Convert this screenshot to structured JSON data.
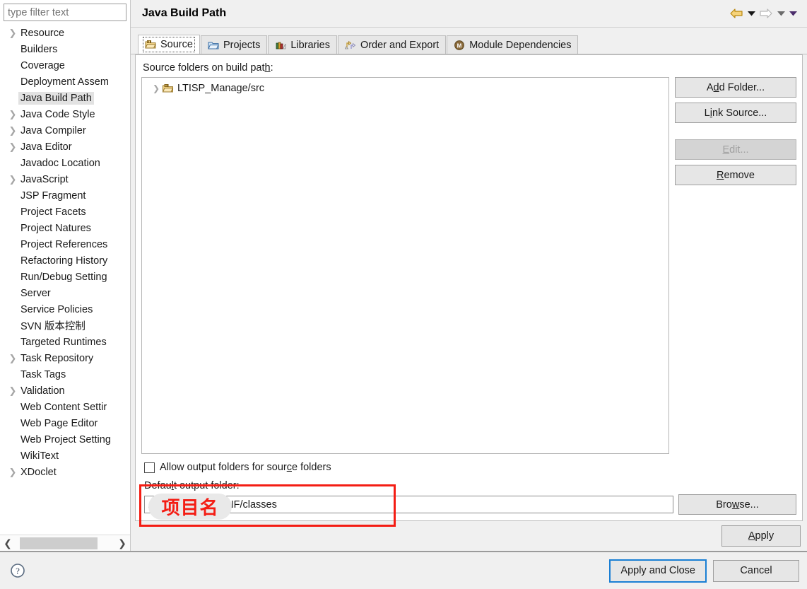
{
  "sidebar": {
    "filter": {
      "placeholder": "type filter text",
      "value": ""
    },
    "items": [
      {
        "label": "Resource",
        "expandable": true,
        "selected": false
      },
      {
        "label": "Builders",
        "expandable": false,
        "selected": false
      },
      {
        "label": "Coverage",
        "expandable": false,
        "selected": false
      },
      {
        "label": "Deployment Assem",
        "expandable": false,
        "selected": false
      },
      {
        "label": "Java Build Path",
        "expandable": false,
        "selected": true
      },
      {
        "label": "Java Code Style",
        "expandable": true,
        "selected": false
      },
      {
        "label": "Java Compiler",
        "expandable": true,
        "selected": false
      },
      {
        "label": "Java Editor",
        "expandable": true,
        "selected": false
      },
      {
        "label": "Javadoc Location",
        "expandable": false,
        "selected": false
      },
      {
        "label": "JavaScript",
        "expandable": true,
        "selected": false
      },
      {
        "label": "JSP Fragment",
        "expandable": false,
        "selected": false
      },
      {
        "label": "Project Facets",
        "expandable": false,
        "selected": false
      },
      {
        "label": "Project Natures",
        "expandable": false,
        "selected": false
      },
      {
        "label": "Project References",
        "expandable": false,
        "selected": false
      },
      {
        "label": "Refactoring History",
        "expandable": false,
        "selected": false
      },
      {
        "label": "Run/Debug Setting",
        "expandable": false,
        "selected": false
      },
      {
        "label": "Server",
        "expandable": false,
        "selected": false
      },
      {
        "label": "Service Policies",
        "expandable": false,
        "selected": false
      },
      {
        "label": "SVN 版本控制",
        "expandable": false,
        "selected": false
      },
      {
        "label": "Targeted Runtimes",
        "expandable": false,
        "selected": false
      },
      {
        "label": "Task Repository",
        "expandable": true,
        "selected": false
      },
      {
        "label": "Task Tags",
        "expandable": false,
        "selected": false
      },
      {
        "label": "Validation",
        "expandable": true,
        "selected": false
      },
      {
        "label": "Web Content Settir",
        "expandable": false,
        "selected": false
      },
      {
        "label": "Web Page Editor",
        "expandable": false,
        "selected": false
      },
      {
        "label": "Web Project Setting",
        "expandable": false,
        "selected": false
      },
      {
        "label": "WikiText",
        "expandable": false,
        "selected": false
      },
      {
        "label": "XDoclet",
        "expandable": true,
        "selected": false
      }
    ],
    "scroll_left_icon": "chevron-left-icon",
    "scroll_right_icon": "chevron-right-icon"
  },
  "header": {
    "title": "Java Build Path",
    "nav": {
      "back_icon": "back-arrow-icon",
      "back_menu_icon": "chevron-down-icon",
      "forward_icon": "forward-arrow-icon",
      "forward_menu_icon": "chevron-down-icon",
      "view_menu_icon": "chevron-down-icon"
    }
  },
  "tabs": [
    {
      "label": "Source",
      "icon": "source-folder-icon",
      "active": true
    },
    {
      "label": "Projects",
      "icon": "projects-folder-icon",
      "active": false
    },
    {
      "label": "Libraries",
      "icon": "libraries-books-icon",
      "active": false
    },
    {
      "label": "Order and Export",
      "icon": "order-export-icon",
      "active": false
    },
    {
      "label": "Module Dependencies",
      "icon": "module-dependencies-icon",
      "active": false
    }
  ],
  "main": {
    "source_folders_label": "Source folders on build path:",
    "source_tree": [
      {
        "label": "LTISP_Manage/src",
        "icon": "source-folder-icon",
        "expandable": true
      }
    ],
    "buttons": [
      {
        "label": "Add Folder...",
        "name": "add-folder-button",
        "disabled": false
      },
      {
        "label": "Link Source...",
        "name": "link-source-button",
        "disabled": false
      },
      {
        "label": "Edit...",
        "name": "edit-button",
        "disabled": true
      },
      {
        "label": "Remove",
        "name": "remove-button",
        "disabled": false
      }
    ],
    "allow_output_checkbox": {
      "label": "Allow output folders for source folders",
      "checked": false
    },
    "default_output_label": "Default output folder:",
    "default_output_value": "/WebRoot/WEB-INF/classes",
    "browse_label": "Browse...",
    "apply_label": "Apply"
  },
  "annotation": {
    "pill_text": "项目名",
    "box_color": "#f41d14",
    "text_color": "#f41d14"
  },
  "footer": {
    "help_icon": "help-question-icon",
    "apply_and_close_label": "Apply and Close",
    "cancel_label": "Cancel"
  }
}
